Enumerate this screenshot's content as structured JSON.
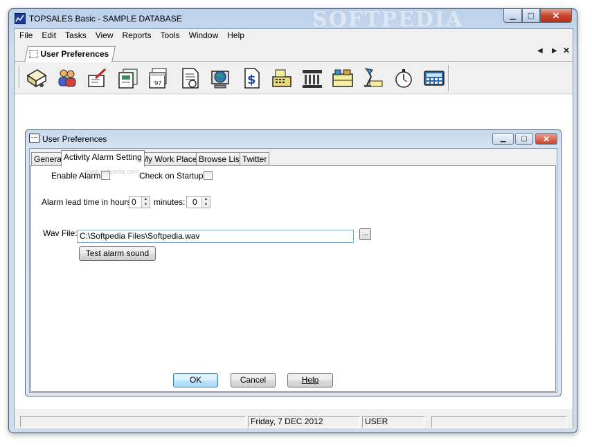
{
  "window": {
    "title": "TOPSALES Basic - SAMPLE DATABASE",
    "watermark": "SOFTPEDIA",
    "minimize_glyph": "▁",
    "maximize_glyph": "▢",
    "close_glyph": "✕"
  },
  "menu": [
    "File",
    "Edit",
    "Tasks",
    "View",
    "Reports",
    "Tools",
    "Window",
    "Help"
  ],
  "doc_tab": {
    "label": "User Preferences",
    "prev_glyph": "◀",
    "next_glyph": "▶",
    "close_glyph": "✕"
  },
  "toolbar_icons": [
    "open-folder-icon",
    "contacts-icon",
    "activity-pen-icon",
    "cards-icon",
    "calendar-icon",
    "document-icon",
    "globe-computer-icon",
    "dollar-doc-icon",
    "cash-register-icon",
    "bank-icon",
    "store-icon",
    "desk-lamp-icon",
    "stopwatch-icon",
    "calculator-icon"
  ],
  "dialog": {
    "title": "User Preferences",
    "tabs": [
      "General",
      "Activity Alarm Setting",
      "My Work Place",
      "Browse List",
      "Twitter"
    ],
    "active_tab": "Activity Alarm Setting",
    "enable_alarm_label": "Enable Alarm",
    "enable_alarm_checked": false,
    "check_startup_label": "Check on Startup",
    "check_startup_checked": false,
    "lead_time_label": "Alarm lead time in hours:",
    "lead_hours": "0",
    "minutes_label": "minutes:",
    "lead_minutes": "0",
    "wav_label": "Wav File:",
    "wav_value": "C:\\Softpedia Files\\Softpedia.wav",
    "browse_label": "...",
    "test_label": "Test alarm sound",
    "ok_label": "OK",
    "cancel_label": "Cancel",
    "help_label": "Help",
    "faint_watermark": "www.softpedia.com"
  },
  "status": {
    "date": "Friday,  7 DEC 2012",
    "user": "USER"
  }
}
